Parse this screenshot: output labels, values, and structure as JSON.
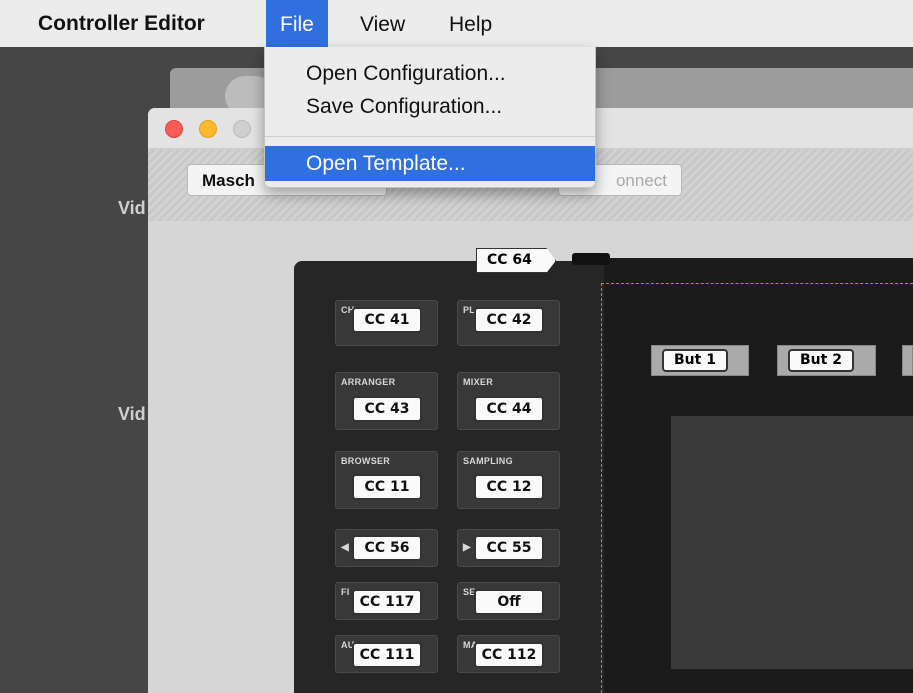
{
  "menubar": {
    "app_name": "Controller Editor",
    "items": [
      "File",
      "View",
      "Help"
    ]
  },
  "file_menu": {
    "items": [
      "Open Configuration...",
      "Save Configuration...",
      "Open Template..."
    ],
    "highlighted": "Open Template..."
  },
  "side_labels": [
    "Vid",
    "Vid"
  ],
  "window": {
    "toolbar": {
      "device_button": "Masch",
      "connect_button": "onnect"
    }
  },
  "controller": {
    "top_tag": "CC 64",
    "cells": [
      {
        "label": "CH",
        "value": "CC 41"
      },
      {
        "label": "PL",
        "value": "CC 42"
      },
      {
        "label": "ARRANGER",
        "value": "CC 43"
      },
      {
        "label": "MIXER",
        "value": "CC 44"
      },
      {
        "label": "BROWSER",
        "value": "CC 11"
      },
      {
        "label": "SAMPLING",
        "value": "CC 12"
      },
      {
        "label": "◀",
        "value": "CC 56"
      },
      {
        "label": "▶",
        "value": "CC 55"
      },
      {
        "label": "FI",
        "value": "CC 117"
      },
      {
        "label": "SE",
        "value": "Off"
      },
      {
        "label": "AU",
        "value": "CC 111"
      },
      {
        "label": "MA",
        "value": "CC 112"
      }
    ],
    "screen_buttons": [
      "But 1",
      "But 2"
    ]
  },
  "colors": {
    "accent": "#2f6fdf",
    "panel": "#262626",
    "selection_dashed": "#c58a1a"
  }
}
